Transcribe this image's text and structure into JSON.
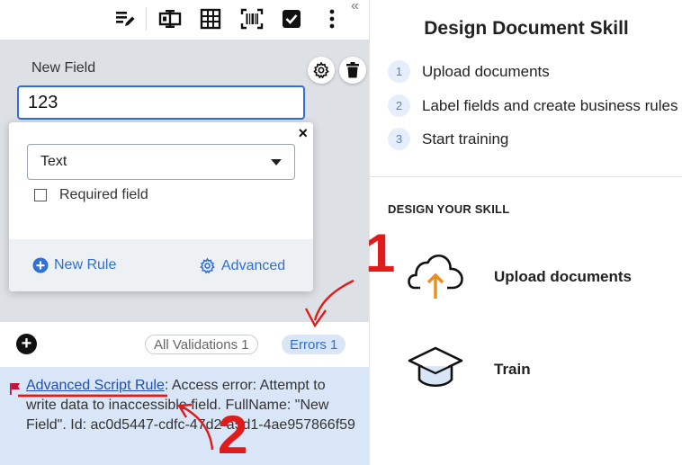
{
  "toolbar": {
    "icons": [
      "edit-list-icon",
      "text-field-icon",
      "table-icon",
      "barcode-icon",
      "checkbox-icon",
      "more-vertical-icon"
    ],
    "collapse_symbol": "«"
  },
  "field": {
    "label": "New Field",
    "value": "123"
  },
  "popup": {
    "close_symbol": "×",
    "type_selected": "Text",
    "required_label": "Required field",
    "new_rule_label": "New Rule",
    "advanced_label": "Advanced"
  },
  "status": {
    "add_symbol": "+",
    "all_validations_label": "All Validations 1",
    "errors_label": "Errors 1"
  },
  "error": {
    "link_text": "Advanced Script Rule",
    "message": ": Access error: Attempt to write data to inaccessible field. FullName: \"New Field\". Id: ac0d5447-cdfc-47d2-a5d1-4ae957866f59"
  },
  "right": {
    "title": "Design Document Skill",
    "steps": [
      {
        "num": "1",
        "label": "Upload documents"
      },
      {
        "num": "2",
        "label": "Label fields and create business rules"
      },
      {
        "num": "3",
        "label": "Start training"
      }
    ],
    "section_heading": "DESIGN YOUR SKILL",
    "actions": [
      {
        "label": "Upload documents",
        "icon": "cloud-upload-icon"
      },
      {
        "label": "Train",
        "icon": "graduation-cap-icon"
      }
    ]
  },
  "annotations": {
    "marker_1": "1",
    "marker_2": "2"
  },
  "colors": {
    "accent": "#2f6fd6",
    "annotation_red": "#e01b1b",
    "upload_arrow": "#f08a1d",
    "error_bg": "#d8e6f8",
    "field_area_bg": "#dde1e6"
  }
}
